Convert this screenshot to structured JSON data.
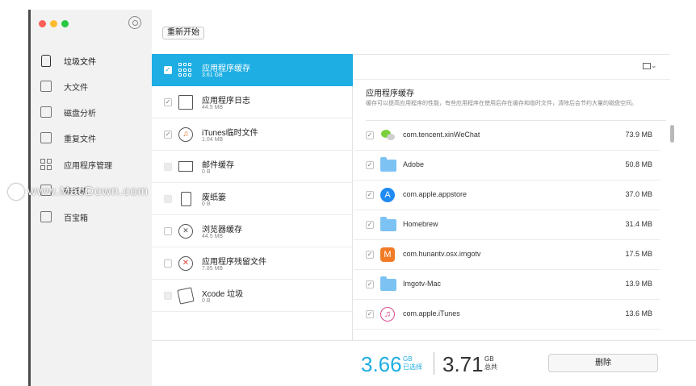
{
  "toolbar": {
    "restart_label": "重新开始"
  },
  "sidebar": {
    "items": [
      {
        "label": "垃圾文件",
        "icon": "trash-can-icon"
      },
      {
        "label": "大文件",
        "icon": "large-file-icon"
      },
      {
        "label": "磁盘分析",
        "icon": "disk-analysis-icon"
      },
      {
        "label": "重复文件",
        "icon": "duplicate-file-icon"
      },
      {
        "label": "应用程序管理",
        "icon": "app-management-icon"
      },
      {
        "label": "碎纸机",
        "icon": "shredder-icon"
      },
      {
        "label": "百宝箱",
        "icon": "toolbox-icon"
      }
    ]
  },
  "categories": [
    {
      "name": "应用程序缓存",
      "size": "3.61 GB",
      "checked": true,
      "selected": true
    },
    {
      "name": "应用程序日志",
      "size": "44.5 MB",
      "checked": true
    },
    {
      "name": "iTunes临时文件",
      "size": "1.04 MB",
      "checked": true
    },
    {
      "name": "邮件缓存",
      "size": "0 B",
      "checked": false
    },
    {
      "name": "废纸篓",
      "size": "0 B",
      "checked": false
    },
    {
      "name": "浏览器缓存",
      "size": "44.5 MB",
      "checked": false
    },
    {
      "name": "应用程序残留文件",
      "size": "7.85 MB",
      "checked": false
    },
    {
      "name": "Xcode 垃圾",
      "size": "0 B",
      "checked": false
    }
  ],
  "detail": {
    "title": "应用程序缓存",
    "description": "缓存可以提高应用程序的性能，有些应用程序在使用后存在缓存和临时文件，清除后会节约大量的磁盘空间。",
    "apps": [
      {
        "name": "com.tencent.xinWeChat",
        "size": "73.9 MB",
        "icon": "wechat-icon"
      },
      {
        "name": "Adobe",
        "size": "50.8 MB",
        "icon": "folder-icon"
      },
      {
        "name": "com.apple.appstore",
        "size": "37.0 MB",
        "icon": "app-store-icon"
      },
      {
        "name": "Homebrew",
        "size": "31.4 MB",
        "icon": "folder-icon"
      },
      {
        "name": "com.hunantv.osx.imgotv",
        "size": "17.5 MB",
        "icon": "mgtv-icon"
      },
      {
        "name": "Imgotv-Mac",
        "size": "13.9 MB",
        "icon": "folder-icon"
      },
      {
        "name": "com.apple.iTunes",
        "size": "13.6 MB",
        "icon": "itunes-icon"
      }
    ]
  },
  "summary": {
    "selected_value": "3.66",
    "selected_unit": "GB",
    "selected_label": "已选择",
    "total_value": "3.71",
    "total_unit": "GB",
    "total_label": "总共",
    "delete_label": "删除"
  },
  "watermark": {
    "text": "www.MacDown.com"
  },
  "colors": {
    "accent": "#1eaee3",
    "sidebar_bg": "#f2f2f2"
  }
}
